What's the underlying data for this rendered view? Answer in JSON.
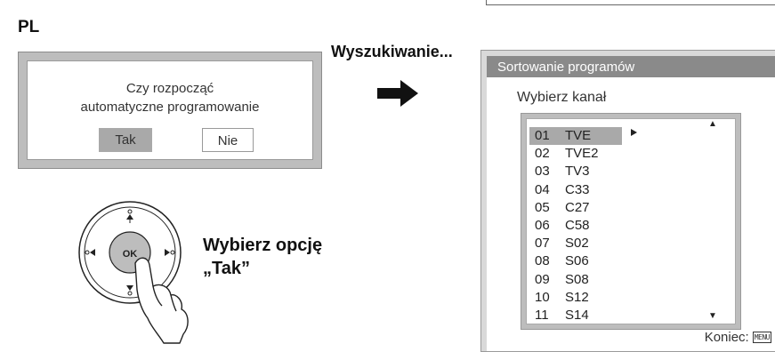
{
  "lang_label": "PL",
  "dialog": {
    "question_line1": "Czy rozpocząć",
    "question_line2": "automatyczne programowanie",
    "yes_label": "Tak",
    "no_label": "Nie"
  },
  "searching_text": "Wyszukiwanie...",
  "choose": {
    "line1": "Wybierz opcję",
    "line2": "„Tak”"
  },
  "remote": {
    "ok_label": "OK"
  },
  "panel": {
    "title": "Sortowanie programów",
    "subtitle": "Wybierz kanał",
    "selected_index": 0,
    "programs": [
      {
        "num": "01",
        "name": "TVE"
      },
      {
        "num": "02",
        "name": "TVE2"
      },
      {
        "num": "03",
        "name": "TV3"
      },
      {
        "num": "04",
        "name": "C33"
      },
      {
        "num": "05",
        "name": "C27"
      },
      {
        "num": "06",
        "name": "C58"
      },
      {
        "num": "07",
        "name": "S02"
      },
      {
        "num": "08",
        "name": "S06"
      },
      {
        "num": "09",
        "name": "S08"
      },
      {
        "num": "10",
        "name": "S12"
      },
      {
        "num": "11",
        "name": "S14"
      }
    ],
    "footer_label": "Koniec:",
    "menu_key_label": "MENU"
  },
  "icons": {
    "arrow": "right-arrow-icon",
    "scroll_up": "up-arrow-icon",
    "scroll_down": "down-arrow-icon",
    "remote": "remote-dpad-icon",
    "hand": "pressing-hand-icon"
  }
}
